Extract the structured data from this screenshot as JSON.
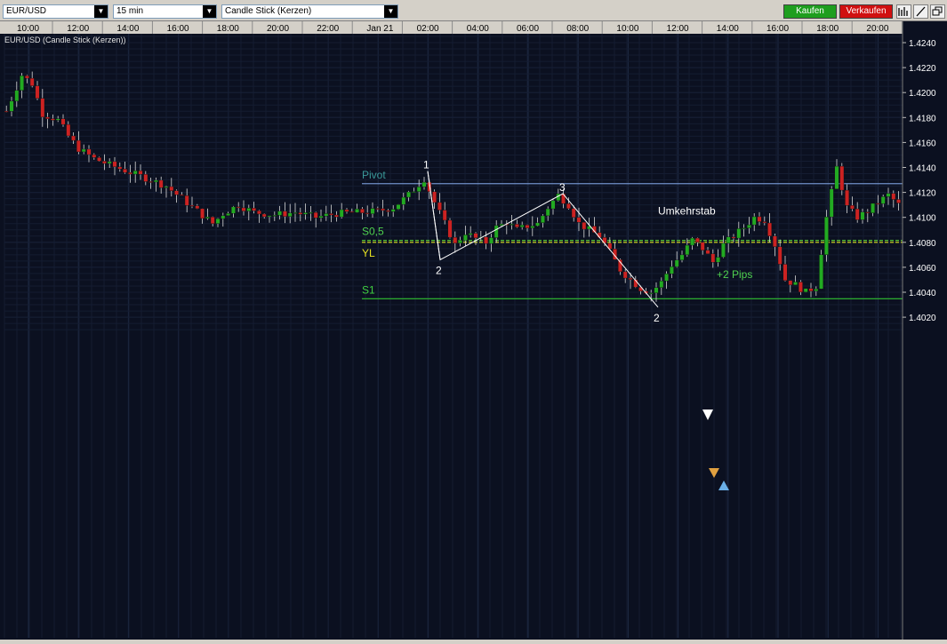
{
  "toolbar": {
    "symbol": "EUR/USD",
    "timeframe": "15 min",
    "chart_type": "Candle Stick (Kerzen)",
    "buy_label": "Kaufen",
    "sell_label": "Verkaufen",
    "colors": {
      "buy": "#1e9e1e",
      "sell": "#d01010"
    }
  },
  "chart": {
    "header_label": "EUR/USD (Candle Stick (Kerzen))",
    "time_labels": [
      "10:00",
      "12:00",
      "14:00",
      "16:00",
      "18:00",
      "20:00",
      "22:00",
      "Jan 21",
      "02:00",
      "04:00",
      "06:00",
      "08:00",
      "10:00",
      "12:00",
      "14:00",
      "16:00",
      "18:00",
      "20:00"
    ],
    "price_labels": [
      "1.4240",
      "1.4220",
      "1.4200",
      "1.4180",
      "1.4160",
      "1.4140",
      "1.4120",
      "1.4100",
      "1.4080",
      "1.4060",
      "1.4040",
      "1.4020"
    ],
    "levels": [
      {
        "name": "Pivot",
        "value": 1.4127,
        "color": "#6f8fc8",
        "dashed": false,
        "label_color": "#3a9a9a"
      },
      {
        "name": "S0,5",
        "value": 1.40815,
        "color": "#5fd63a",
        "dashed": true,
        "label_color": "#4fd14f"
      },
      {
        "name": "YL",
        "value": 1.408,
        "color": "#e0e020",
        "dashed": true,
        "label_color": "#e6e020"
      },
      {
        "name": "S1",
        "value": 1.40348,
        "color": "#2fc02f",
        "dashed": false,
        "label_color": "#3fd03f"
      }
    ],
    "annotations": {
      "wave_points": [
        "1",
        "2",
        "3",
        "2"
      ],
      "umkehrstab": "Umkehrstab",
      "pips": "+2 Pips"
    },
    "colors": {
      "bull": "#22aa22",
      "bear": "#cc2222",
      "grid": "#1e2a45",
      "background": "#0b1020",
      "axis_text": "#ffffff"
    }
  }
}
